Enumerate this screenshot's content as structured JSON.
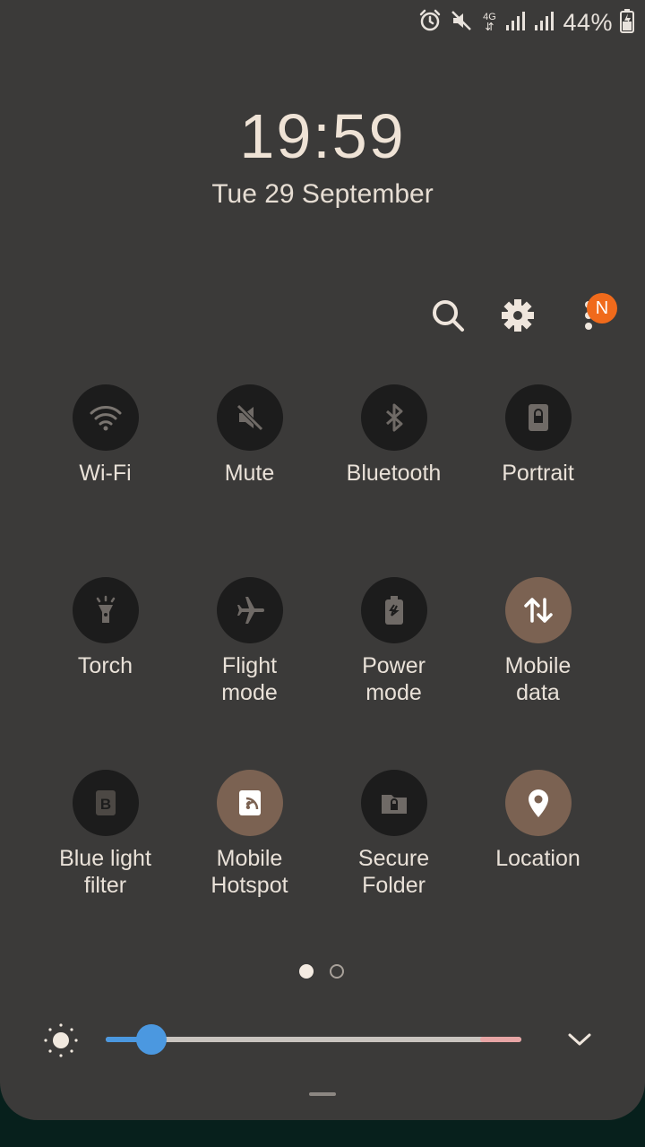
{
  "status_bar": {
    "icons": [
      "alarm-icon",
      "mute-status-icon",
      "4g-data-icon",
      "signal-icon",
      "signal-icon",
      "battery-charging-icon"
    ],
    "network_label": "4G",
    "battery": "44%"
  },
  "clock": {
    "time": "19:59",
    "date": "Tue 29 September"
  },
  "toolbar": {
    "icons": [
      "search-icon",
      "gear-icon",
      "more-options-icon"
    ],
    "notification_badge": "N",
    "badge_color": "#f06a1b"
  },
  "tiles": [
    {
      "label": "Wi-Fi",
      "icon": "wifi-icon",
      "active": false
    },
    {
      "label": "Mute",
      "icon": "mute-icon",
      "active": false
    },
    {
      "label": "Bluetooth",
      "icon": "bluetooth-icon",
      "active": false
    },
    {
      "label": "Portrait",
      "icon": "portrait-lock-icon",
      "active": false
    },
    {
      "label": "Torch",
      "icon": "torch-icon",
      "active": false
    },
    {
      "label": "Flight mode",
      "icon": "airplane-icon",
      "active": false
    },
    {
      "label": "Power mode",
      "icon": "power-mode-icon",
      "active": false
    },
    {
      "label": "Mobile data",
      "icon": "mobile-data-icon",
      "active": true
    },
    {
      "label": "Blue light filter",
      "icon": "blue-light-icon",
      "active": false
    },
    {
      "label": "Mobile Hotspot",
      "icon": "hotspot-icon",
      "active": true
    },
    {
      "label": "Secure Folder",
      "icon": "secure-folder-icon",
      "active": false
    },
    {
      "label": "Location",
      "icon": "location-pin-icon",
      "active": true
    }
  ],
  "pager": {
    "current_page": 1,
    "total_pages": 2
  },
  "brightness": {
    "level": 0.08,
    "accent": "#4b98e0"
  },
  "colors": {
    "panel_bg": "#3b3a39",
    "tile_off": "#1c1c1c",
    "tile_on": "#7b6252"
  }
}
